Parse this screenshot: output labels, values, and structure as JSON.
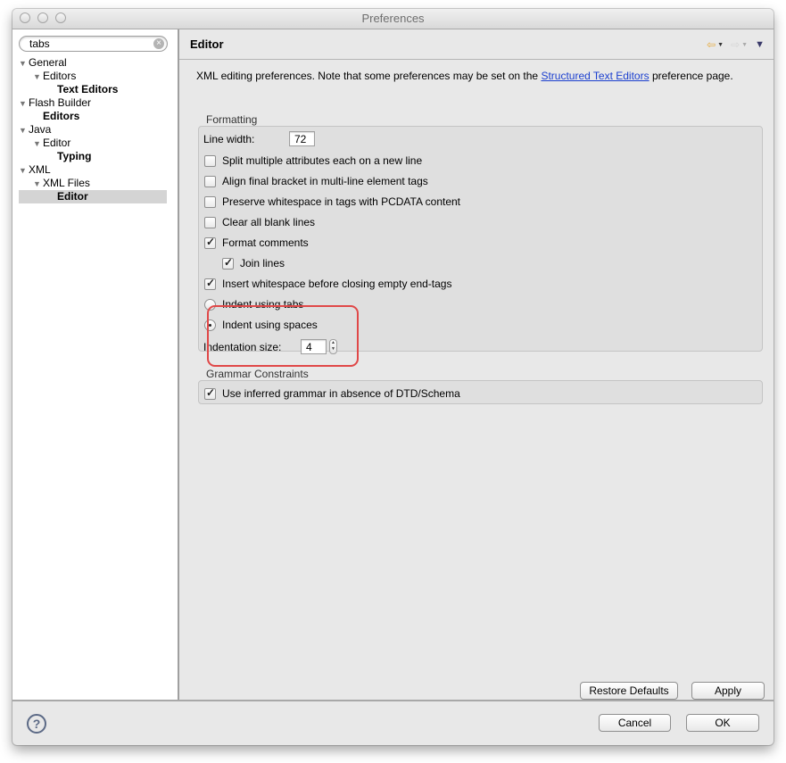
{
  "window": {
    "title": "Preferences"
  },
  "sidebar": {
    "search": {
      "value": "tabs"
    },
    "tree": [
      {
        "label": "General",
        "level": 0,
        "expanded": true,
        "bold": false
      },
      {
        "label": "Editors",
        "level": 1,
        "expanded": true,
        "bold": false
      },
      {
        "label": "Text Editors",
        "level": 2,
        "bold": true
      },
      {
        "label": "Flash Builder",
        "level": 0,
        "expanded": true,
        "bold": false
      },
      {
        "label": "Editors",
        "level": 1,
        "bold": true
      },
      {
        "label": "Java",
        "level": 0,
        "expanded": true,
        "bold": false
      },
      {
        "label": "Editor",
        "level": 1,
        "expanded": true,
        "bold": false
      },
      {
        "label": "Typing",
        "level": 2,
        "bold": true
      },
      {
        "label": "XML",
        "level": 0,
        "expanded": true,
        "bold": false
      },
      {
        "label": "XML Files",
        "level": 1,
        "expanded": true,
        "bold": false
      },
      {
        "label": "Editor",
        "level": 2,
        "bold": true,
        "selected": true
      }
    ]
  },
  "page": {
    "title": "Editor",
    "nav": {
      "back_icon": "back-arrow-icon",
      "forward_icon": "forward-arrow-icon",
      "menu_icon": "view-menu-icon"
    },
    "description_prefix": "XML editing preferences.  Note that some preferences may be set on the ",
    "description_link": "Structured Text Editors",
    "description_suffix": " preference page.",
    "formatting": {
      "label": "Formatting",
      "line_width_label": "Line width:",
      "line_width_value": "72",
      "options": [
        {
          "label": "Split multiple attributes each on a new line",
          "checked": false
        },
        {
          "label": "Align final bracket in multi-line element tags",
          "checked": false
        },
        {
          "label": "Preserve whitespace in tags with PCDATA content",
          "checked": false
        },
        {
          "label": "Clear all blank lines",
          "checked": false
        },
        {
          "label": "Format comments",
          "checked": true
        },
        {
          "label": "Join lines",
          "checked": true
        },
        {
          "label": "Insert whitespace before closing empty end-tags",
          "checked": true
        }
      ],
      "indent_tabs_label": "Indent using tabs",
      "indent_tabs_selected": false,
      "indent_spaces_label": "Indent using spaces",
      "indent_spaces_selected": true,
      "indent_size_label": "Indentation size:",
      "indent_size_value": "4"
    },
    "grammar": {
      "label": "Grammar Constraints",
      "option": {
        "label": "Use inferred grammar in absence of DTD/Schema",
        "checked": true
      }
    },
    "restore_defaults_label": "Restore Defaults",
    "apply_label": "Apply"
  },
  "footer": {
    "help_icon": "help-icon",
    "cancel_label": "Cancel",
    "ok_label": "OK"
  },
  "colors": {
    "link": "#1b3fcf",
    "highlight": "#e04848"
  }
}
